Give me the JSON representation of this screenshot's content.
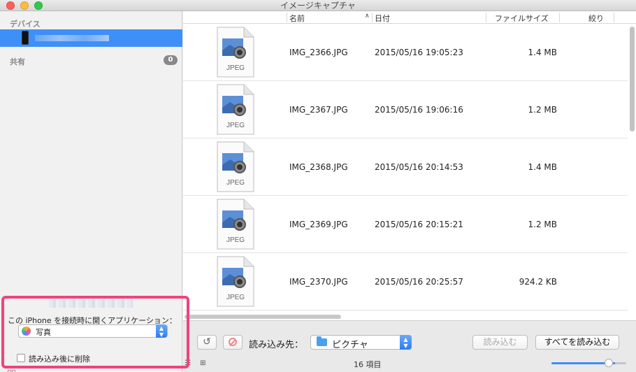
{
  "window": {
    "title": "イメージキャプチャ"
  },
  "sidebar": {
    "devices_heading": "デバイス",
    "shared_heading": "共有",
    "shared_count": "0",
    "options": {
      "open_app_label": "この iPhone を接続時に開くアプリケーション：",
      "open_app_value": "写真",
      "delete_after_import_label": "読み込み後に削除",
      "delete_after_import_checked": false
    }
  },
  "table": {
    "columns": {
      "name": "名前",
      "date": "日付",
      "size": "ファイルサイズ",
      "aperture": "絞り"
    },
    "file_icon_label": "JPEG",
    "rows": [
      {
        "name": "IMG_2366.JPG",
        "date": "2015/05/16 19:05:23",
        "size": "1.4 MB"
      },
      {
        "name": "IMG_2367.JPG",
        "date": "2015/05/16 19:06:16",
        "size": "1.2 MB"
      },
      {
        "name": "IMG_2368.JPG",
        "date": "2015/05/16 20:14:53",
        "size": "1.4 MB"
      },
      {
        "name": "IMG_2369.JPG",
        "date": "2015/05/16 20:15:21",
        "size": "1.2 MB"
      },
      {
        "name": "IMG_2370.JPG",
        "date": "2015/05/16 20:25:57",
        "size": "924.2 KB"
      }
    ]
  },
  "toolbar": {
    "import_to_label": "読み込み先：",
    "import_to_value": "ピクチャ",
    "import_button": "読み込む",
    "import_all_button": "すべてを読み込む",
    "item_count": "16 項目",
    "view_toggle": "☷ ⊞",
    "zoom_level": 0.85
  },
  "colors": {
    "selection": "#3e8ff8",
    "highlight_border": "#f0437f",
    "select_arrow": "#2d7cf0"
  },
  "icons": [
    "phone-icon",
    "photos-app-icon",
    "jpeg-file-icon",
    "rotate-icon",
    "delete-icon",
    "folder-icon",
    "chevron-up-down-icon"
  ]
}
